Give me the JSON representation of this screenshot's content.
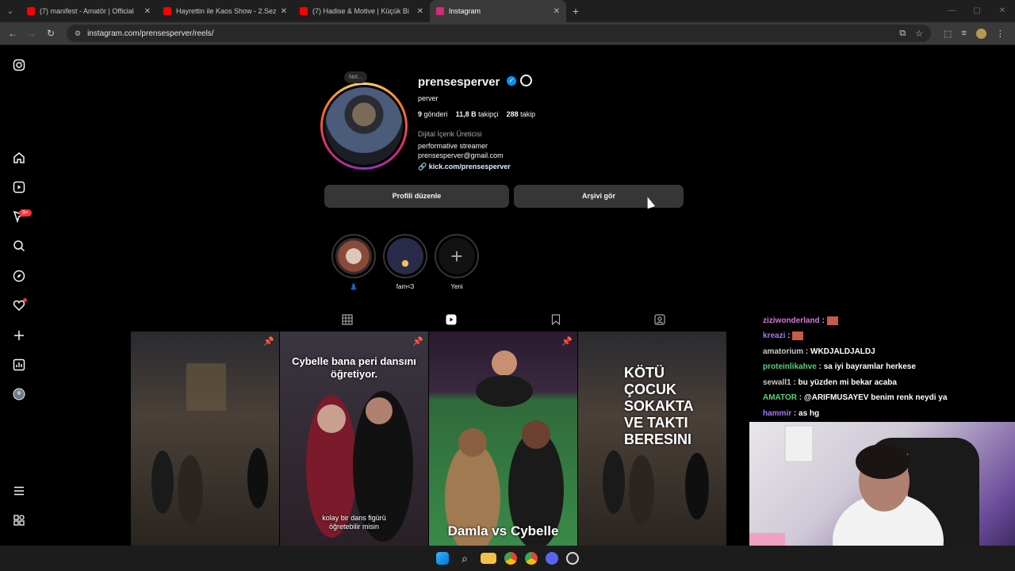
{
  "browser": {
    "tabs": [
      {
        "title": "(7) manifest - Amatör | Official",
        "color": "#ff0000"
      },
      {
        "title": "Hayrettin ile Kaos Show - 2.Sez",
        "color": "#ff0000"
      },
      {
        "title": "(7) Hadise & Motive | Küçük Bi",
        "color": "#ff0000"
      },
      {
        "title": "Instagram",
        "color": "#d62976"
      }
    ],
    "url": "instagram.com/prensesperver/reels/"
  },
  "sidebar": {
    "icons": [
      "instagram-icon",
      "home-icon",
      "reels-icon",
      "messages-icon",
      "search-icon",
      "explore-icon",
      "notifications-icon",
      "create-icon",
      "dashboard-icon",
      "profile-icon",
      "menu-icon",
      "meta-icon"
    ],
    "messages_badge": "9+"
  },
  "profile": {
    "note": "Not...",
    "username": "prensesperver",
    "fullname": "perver",
    "posts_count": "9",
    "posts_label": "gönderi",
    "followers_count": "11,8 B",
    "followers_label": "takipçi",
    "following_count": "288",
    "following_label": "takip",
    "category": "Dijital İçerik Üreticisi",
    "bio_line1": "performative streamer",
    "bio_line2": "prensesperver@gmail.com",
    "link": "kick.com/prensesperver",
    "edit_button": "Profili düzenle",
    "archive_button": "Arşivi gör"
  },
  "highlights": [
    {
      "label": "👗",
      "color": "#8a6a5a"
    },
    {
      "label": "fam<3",
      "color": "#2a2a4a"
    },
    {
      "label": "Yeni",
      "color": "#111111"
    }
  ],
  "reels": [
    {
      "overlay_top": "",
      "overlay_bottom": "",
      "pinned": true,
      "color": "#3a3530"
    },
    {
      "overlay_top": "Cybelle bana peri dansını öğretiyor.",
      "overlay_bottom": "kolay bir dans figürü öğretebilir misin",
      "pinned": true,
      "color": "#2a2028"
    },
    {
      "overlay_top": "",
      "overlay_bottom": "Damla vs Cybelle",
      "pinned": true,
      "color": "#2f6a3a"
    },
    {
      "overlay_top": "KÖTÜ ÇOCUK SOKAKTA VE TAKTI BERESINI",
      "overlay_bottom": "",
      "pinned": false,
      "color": "#3a3530"
    }
  ],
  "chat": [
    {
      "user": "ziziwonderland",
      "text": "",
      "color": "#d07ad7"
    },
    {
      "user": "kreazi",
      "text": "",
      "color": "#a678f0"
    },
    {
      "user": "amatorium",
      "text": "WKDJALDJALDJ",
      "color": "#c9c9c9"
    },
    {
      "user": "proteinlikahve",
      "text": "sa iyi bayramlar herkese",
      "color": "#5ad07a"
    },
    {
      "user": "sewall1",
      "text": "bu yüzden mi bekar acaba",
      "color": "#c9c9c9"
    },
    {
      "user": "AMATOR",
      "text": "@ARIFMUSAYEV benim renk neydi ya",
      "color": "#5ad07a"
    },
    {
      "user": "hammir",
      "text": "as hg",
      "color": "#a678f0"
    }
  ]
}
